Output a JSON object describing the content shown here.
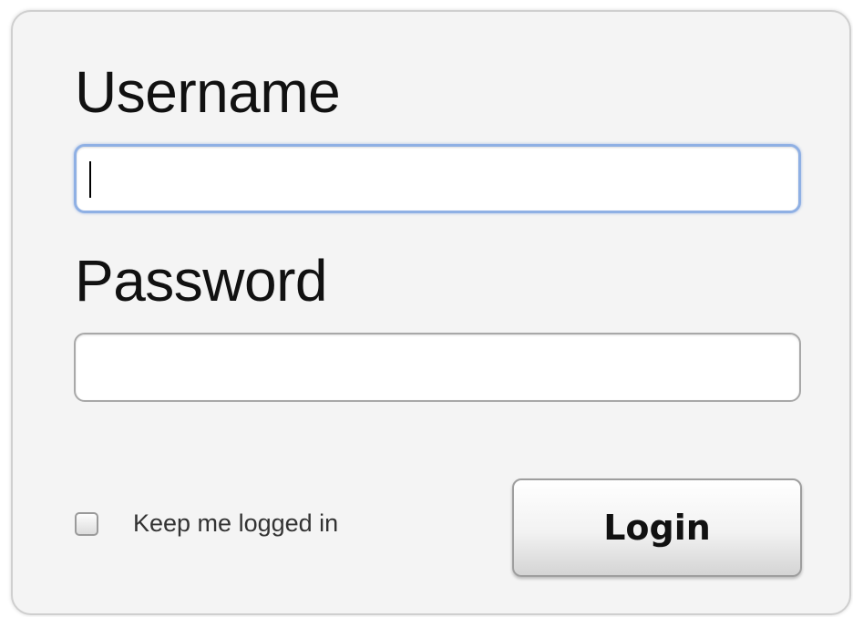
{
  "form": {
    "username_label": "Username",
    "username_value": "",
    "password_label": "Password",
    "password_value": "",
    "remember_label": "Keep me logged in",
    "remember_checked": false,
    "login_label": "Login"
  },
  "colors": {
    "panel_background": "#f4f4f4",
    "focus_border": "#8fb0e4",
    "label_text": "#111111"
  }
}
